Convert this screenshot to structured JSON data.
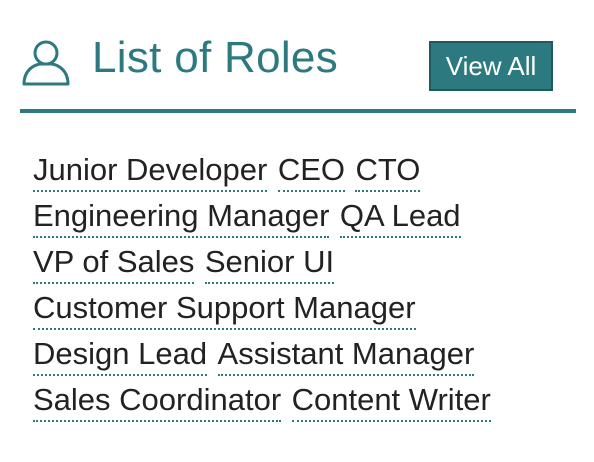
{
  "header": {
    "icon": "user-icon",
    "title": "List of Roles",
    "view_all_label": "View All"
  },
  "colors": {
    "accent": "#2c7a80",
    "text": "#222222",
    "background": "#ffffff"
  },
  "roles": {
    "line0": [
      "Junior Developer",
      "CEO",
      "CTO"
    ],
    "line1": [
      "Engineering Manager",
      "QA Lead"
    ],
    "line2": [
      "VP of Sales",
      "Senior UI"
    ],
    "line3": [
      "Customer Support Manager"
    ],
    "line4": [
      "Design Lead",
      "Assistant Manager"
    ],
    "line5": [
      "Sales Coordinator",
      "Content Writer"
    ]
  }
}
